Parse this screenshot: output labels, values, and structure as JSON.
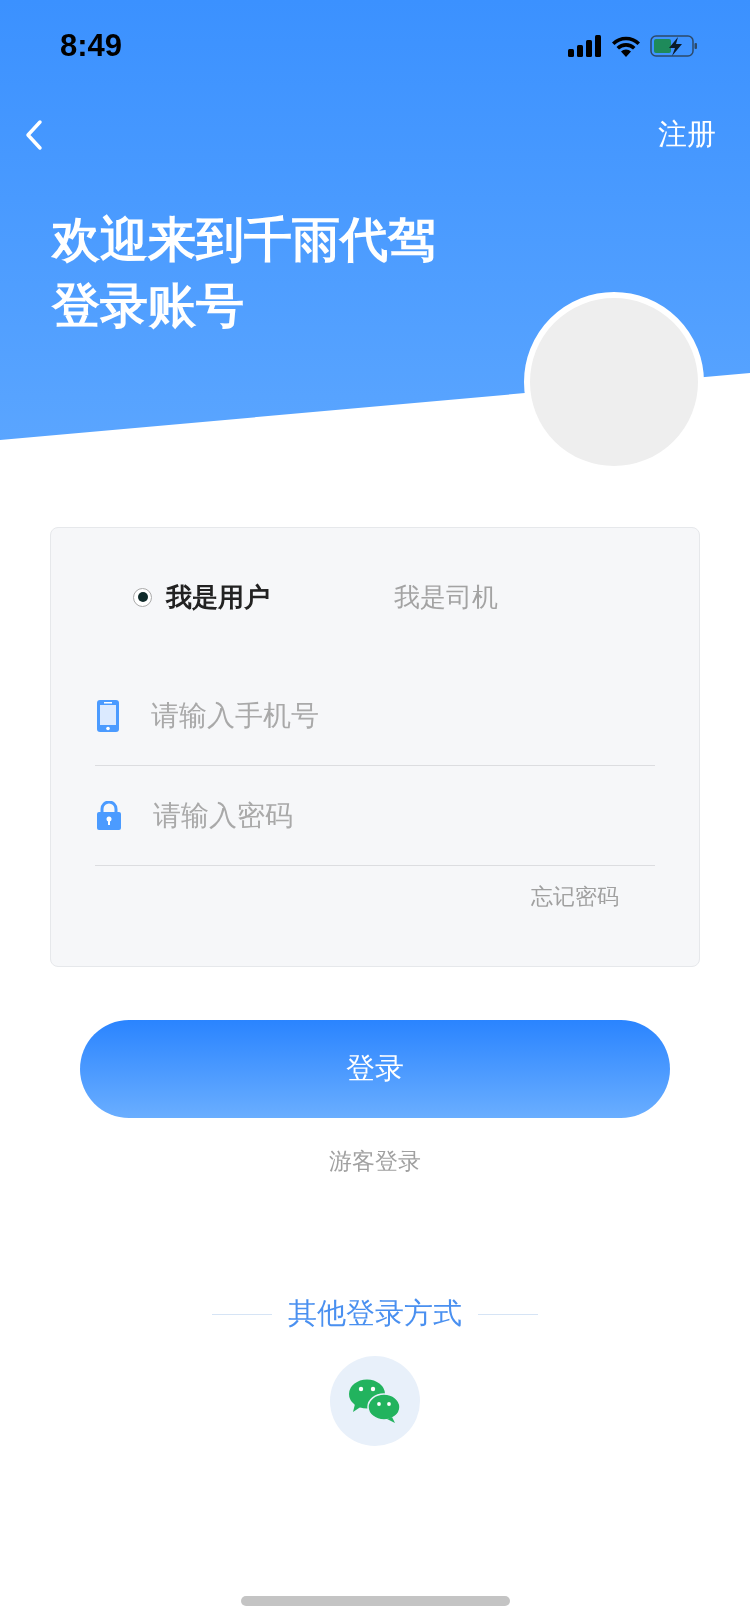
{
  "status_bar": {
    "time": "8:49"
  },
  "nav": {
    "action": "注册"
  },
  "title_lines": [
    "欢迎来到千雨代驾",
    "登录账号"
  ],
  "roles": [
    {
      "label": "我是用户",
      "selected": true
    },
    {
      "label": "我是司机",
      "selected": false
    }
  ],
  "fields": [
    {
      "kind": "phone",
      "placeholder": "请输入手机号"
    },
    {
      "kind": "password",
      "placeholder": "请输入密码"
    }
  ],
  "forgot_link": "忘记密码",
  "login_button": "登录",
  "guest_link": "游客登录",
  "other_login": {
    "title": "其他登录方式"
  }
}
